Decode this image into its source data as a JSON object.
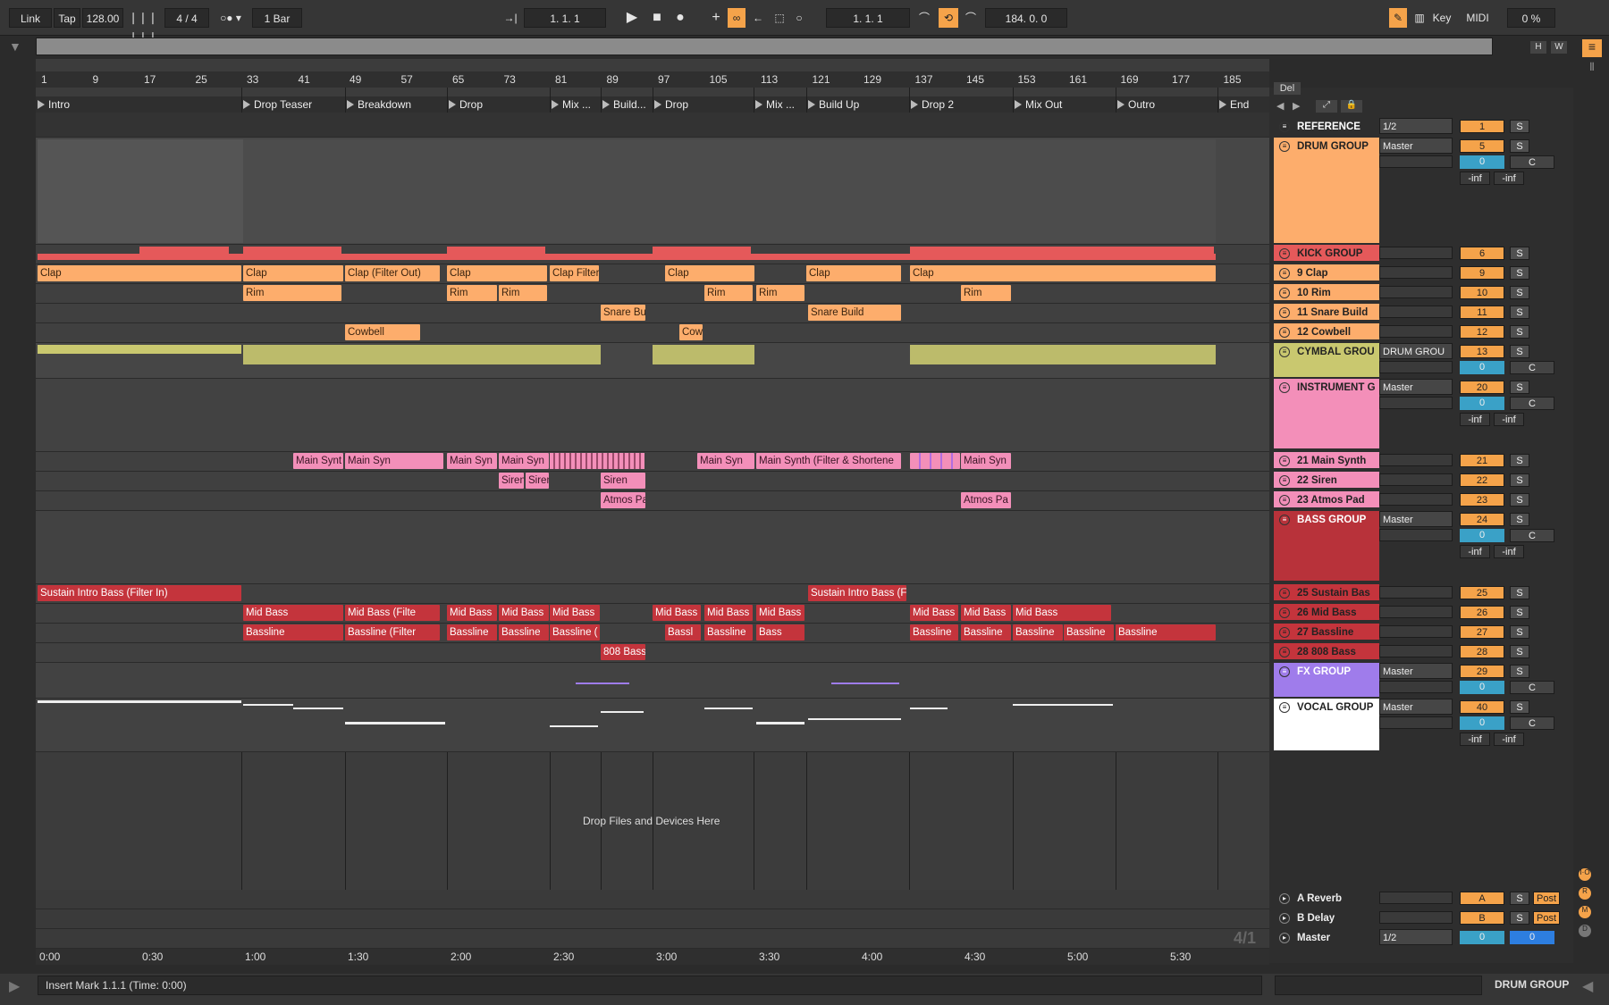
{
  "transport": {
    "link": "Link",
    "tap": "Tap",
    "tempo": "128.00",
    "signature": "4 / 4",
    "quantize": "1 Bar",
    "position": "1.  1.  1",
    "loop_start": "1.  1.  1",
    "loop_length": "184.  0.  0",
    "key": "Key",
    "midi": "MIDI",
    "cpu": "0 %"
  },
  "overview": {
    "h": "H",
    "w": "W"
  },
  "ruler": [
    "1",
    "9",
    "17",
    "25",
    "33",
    "41",
    "49",
    "57",
    "65",
    "73",
    "81",
    "89",
    "97",
    "105",
    "113",
    "121",
    "129",
    "137",
    "145",
    "153",
    "161",
    "169",
    "177",
    "185"
  ],
  "locators": [
    "Intro",
    "Drop Teaser",
    "Breakdown",
    "Drop",
    "Mix ...",
    "Build...",
    "Drop",
    "Mix ...",
    "Build Up",
    "Drop 2",
    "Mix Out",
    "Outro",
    "End"
  ],
  "time_ruler": [
    "0:00",
    "0:30",
    "1:00",
    "1:30",
    "2:00",
    "2:30",
    "3:00",
    "3:30",
    "4:00",
    "4:30",
    "5:00",
    "5:30"
  ],
  "signature_overlay": "4/1",
  "clips": {
    "clap1": "Clap",
    "clap2": "Clap (Filter Out)",
    "clap3": "Clap",
    "clap4": "Clap Filter",
    "clap5": "Clap",
    "clap6": "Clap",
    "clap7": "Clap",
    "rim1": "Rim",
    "rim2": "Rim",
    "rim3": "Rim",
    "rim4": "Rim",
    "rim5": "Rim",
    "rim6": "Rim",
    "snare1": "Snare Bu",
    "snare2": "Snare Build",
    "cowbell1": "Cowbell",
    "cowbell2": "Cow",
    "synth1": "Main Synt",
    "synth2": "Main Syn",
    "synth3": "Main Syn",
    "synth4": "Main Syn",
    "synth5": "Main Synth (Filter & Shortene",
    "synth6": "Main Syn",
    "siren1": "Siren",
    "siren2": "Siren",
    "siren3": "Siren",
    "atmos1": "Atmos Pa",
    "atmos2": "Atmos Pa",
    "sustain1": "Sustain Intro Bass (Filter In)",
    "sustain2": "Sustain Intro Bass (F",
    "mid1": "Mid Bass",
    "mid2": "Mid Bass (Filte",
    "mid3": "Mid Bass",
    "mid4": "Mid Bass",
    "mid5": "Mid Bass",
    "mid6": "Mid Bass",
    "mid7": "Mid Bass",
    "mid8": "Mid Bass",
    "mid9": "Mid Bass",
    "mid10": "Mid Bass",
    "mid11": "Mid Bass",
    "bl1": "Bassline",
    "bl2": "Bassline (Filter",
    "bl3": "Bassline",
    "bl4": "Bassline",
    "bl5": "Bassline (",
    "bl6": "Bassl",
    "bl7": "Bassline",
    "bl8": "Bass",
    "bl9": "Bassline",
    "bl10": "Bassline",
    "bl11": "Bassline",
    "bl12": "Bassline",
    "bl13": "Bassline",
    "b808": "808 Bass"
  },
  "drop_hint": "Drop Files and Devices Here",
  "mixer": {
    "del": "Del",
    "tracks": [
      {
        "name": "REFERENCE",
        "route": "1/2",
        "num": "1",
        "solo": "S",
        "color": "#2e2e2e"
      },
      {
        "name": "DRUM GROUP",
        "route": "Master",
        "num": "5",
        "solo": "S",
        "pan": "0",
        "c": "C",
        "inf1": "-inf",
        "inf2": "-inf",
        "color": "#fdad6c"
      },
      {
        "name": "KICK GROUP",
        "num": "6",
        "solo": "S",
        "color": "#e5595a"
      },
      {
        "name": "9 Clap",
        "num": "9",
        "solo": "S",
        "color": "#fdad6c"
      },
      {
        "name": "10 Rim",
        "num": "10",
        "solo": "S",
        "color": "#fdad6c"
      },
      {
        "name": "11 Snare Build",
        "num": "11",
        "solo": "S",
        "color": "#fdad6c"
      },
      {
        "name": "12 Cowbell",
        "num": "12",
        "solo": "S",
        "color": "#fdad6c"
      },
      {
        "name": "CYMBAL GROU",
        "route": "DRUM GROU",
        "num": "13",
        "solo": "S",
        "pan": "0",
        "c": "C",
        "color": "#c9c86f"
      },
      {
        "name": "INSTRUMENT G",
        "route": "Master",
        "num": "20",
        "solo": "S",
        "pan": "0",
        "c": "C",
        "inf1": "-inf",
        "inf2": "-inf",
        "color": "#f38fb9"
      },
      {
        "name": "21 Main Synth",
        "num": "21",
        "solo": "S",
        "color": "#f38fb9"
      },
      {
        "name": "22 Siren",
        "num": "22",
        "solo": "S",
        "color": "#f38fb9"
      },
      {
        "name": "23 Atmos Pad",
        "num": "23",
        "solo": "S",
        "color": "#f38fb9"
      },
      {
        "name": "BASS GROUP",
        "route": "Master",
        "num": "24",
        "solo": "S",
        "pan": "0",
        "c": "C",
        "inf1": "-inf",
        "inf2": "-inf",
        "color": "#b8323a"
      },
      {
        "name": "25 Sustain Bas",
        "num": "25",
        "solo": "S",
        "color": "#c4343c"
      },
      {
        "name": "26 Mid Bass",
        "num": "26",
        "solo": "S",
        "color": "#c4343c"
      },
      {
        "name": "27 Bassline",
        "num": "27",
        "solo": "S",
        "color": "#c4343c"
      },
      {
        "name": "28 808 Bass",
        "num": "28",
        "solo": "S",
        "color": "#c4343c"
      },
      {
        "name": "FX GROUP",
        "route": "Master",
        "num": "29",
        "solo": "S",
        "pan": "0",
        "c": "C",
        "color": "#9f7ceb"
      },
      {
        "name": "VOCAL GROUP",
        "route": "Master",
        "num": "40",
        "solo": "S",
        "pan": "0",
        "c": "C",
        "inf1": "-inf",
        "inf2": "-inf",
        "color": "#ffffff"
      }
    ],
    "returns": [
      {
        "name": "A Reverb",
        "num": "A",
        "solo": "S",
        "post": "Post"
      },
      {
        "name": "B Delay",
        "num": "B",
        "solo": "S",
        "post": "Post"
      },
      {
        "name": "Master",
        "route": "1/2",
        "num": "0",
        "num2": "0"
      }
    ]
  },
  "status": {
    "text": "Insert Mark 1.1.1 (Time: 0:00)",
    "selected": "DRUM GROUP"
  },
  "colors": {
    "accent": "#f5a34a",
    "orange": "#fdad6c",
    "red": "#c4343c",
    "pink": "#f38fb9",
    "yellow": "#c9c86f",
    "purple": "#9f7ceb"
  }
}
